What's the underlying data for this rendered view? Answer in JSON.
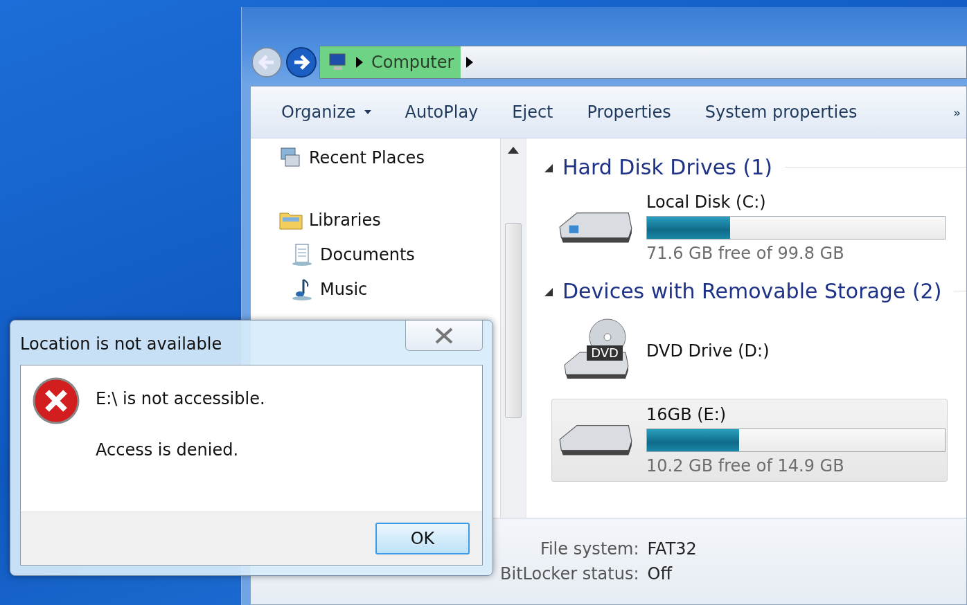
{
  "address_bar": {
    "breadcrumb": "Computer"
  },
  "toolbar": [
    {
      "label": "Organize",
      "kind": "menu"
    },
    {
      "label": "AutoPlay",
      "kind": "button"
    },
    {
      "label": "Eject",
      "kind": "button"
    },
    {
      "label": "Properties",
      "kind": "button"
    },
    {
      "label": "System properties",
      "kind": "button"
    }
  ],
  "toolbar_overflow": "»",
  "nav": [
    {
      "label": "Recent Places",
      "kind": "recent"
    },
    {
      "label": "Libraries",
      "kind": "library",
      "children": [
        {
          "label": "Documents",
          "kind": "documents"
        },
        {
          "label": "Music",
          "kind": "music"
        }
      ]
    }
  ],
  "groups": [
    {
      "title": "Hard Disk Drives (1)",
      "expanded": true,
      "drives": [
        {
          "name": "Local Disk (C:)",
          "kind": "hdd",
          "level": 0.28,
          "free": "71.6 GB free of 99.8 GB",
          "selected": false
        }
      ]
    },
    {
      "title": "Devices with Removable Storage (2)",
      "expanded": true,
      "drives": [
        {
          "name": "DVD Drive (D:)",
          "kind": "dvd",
          "badge": "DVD",
          "selected": false
        },
        {
          "name": "16GB (E:)",
          "kind": "usb",
          "level": 0.31,
          "free": "10.2 GB free of 14.9 GB",
          "selected": true
        }
      ]
    }
  ],
  "details": [
    {
      "label": "File system:",
      "value": "FAT32"
    },
    {
      "label": "BitLocker status:",
      "value": "Off"
    }
  ],
  "dialog": {
    "title": "Location is not available",
    "message": "E:\\ is not accessible.",
    "detail": "Access is denied.",
    "button": "OK"
  }
}
